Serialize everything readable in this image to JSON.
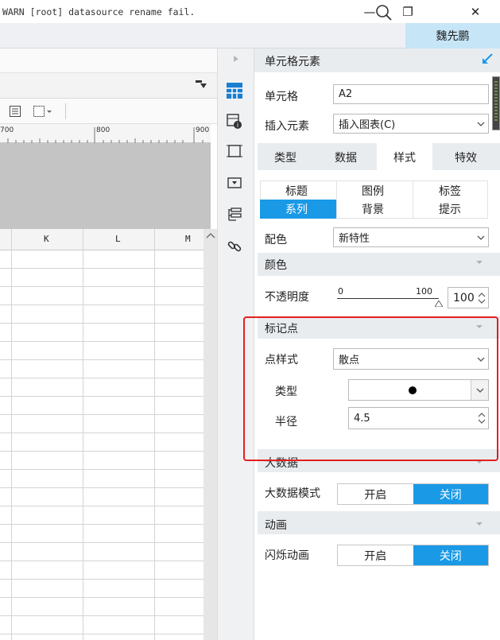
{
  "window": {
    "min_glyph": "—",
    "max_glyph": "❐",
    "close_glyph": "✕"
  },
  "logbar": {
    "log_text": "WARN [root] datasource rename fail.",
    "user_name": "魏先鹏"
  },
  "ruler": {
    "marks": [
      "700",
      "800",
      "900"
    ]
  },
  "sheet": {
    "columns": [
      "K",
      "L",
      "M"
    ]
  },
  "props": {
    "section_title": "单元格元素",
    "cell_label": "单元格",
    "cell_value": "A2",
    "insert_label": "插入元素",
    "insert_value": "插入图表(C)",
    "main_tabs": [
      "类型",
      "数据",
      "样式",
      "特效"
    ],
    "active_main_tab": "样式",
    "sub_tabs_row1": [
      "标题",
      "图例",
      "标签"
    ],
    "sub_tabs_row2": [
      "系列",
      "背景",
      "提示"
    ],
    "active_sub_tab": "系列",
    "palette_label": "配色",
    "palette_value": "新特性",
    "color_band": "颜色",
    "opacity_label": "不透明度",
    "opacity_min": "0",
    "opacity_max": "100",
    "opacity_value": "100",
    "marker_band": "标记点",
    "point_style_label": "点样式",
    "point_style_value": "散点",
    "type_label": "类型",
    "radius_label": "半径",
    "radius_value": "4.5",
    "bigdata_band": "大数据",
    "bigdata_mode_label": "大数据模式",
    "anim_band": "动画",
    "flash_anim_label": "闪烁动画",
    "on_label": "开启",
    "off_label": "关闭"
  },
  "colors": {
    "accent_blue": "#1a99e6",
    "highlight_red": "#e41e1e",
    "user_button_bg": "#c6e5f6"
  },
  "icons": [
    "search-icon",
    "panel-pin-icon",
    "grid-icon",
    "widget-icon",
    "frame-icon",
    "dropdown-box-icon",
    "tree-icon",
    "link-icon",
    "expand-arrow-icon",
    "collapse-icon"
  ]
}
